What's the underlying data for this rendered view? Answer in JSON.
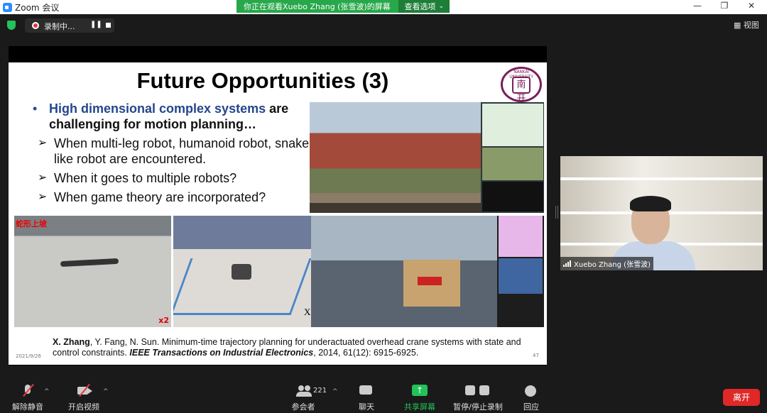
{
  "window": {
    "title": "Zoom 会议",
    "controls": [
      "minimize",
      "restore",
      "close"
    ]
  },
  "share_banner": {
    "message": "你正在观看Xuebo Zhang (张雪波)的屏幕",
    "options_label": "查看选项"
  },
  "topbar": {
    "recording_label": "录制中...",
    "view_label": "视图"
  },
  "slide": {
    "title": "Future Opportunities (3)",
    "logo_text": "NANKAI UNIVERSITY",
    "logo_glyph": "南开",
    "bullet_highlight": "High dimensional complex systems",
    "bullet_rest": " are challenging for motion planning…",
    "sub_bullets": [
      "When multi-leg robot, humanoid robot, snake-like robot are encountered.",
      "When it goes to multiple robots?",
      "When game theory are incorporated?"
    ],
    "photo_tag": "蛇形上坡",
    "speed_label": "x2",
    "x_label": "X",
    "citation_authors": "X. Zhang",
    "citation_mid": ", Y. Fang, N. Sun. Minimum-time trajectory planning for underactuated overhead crane systems with state and control constraints. ",
    "citation_journal": "IEEE Transactions on Industrial Electronics",
    "citation_end": ", 2014, 61(12): 6915-6925.",
    "date": "2021/9/26",
    "page_number": "47"
  },
  "video": {
    "participant_name": "Xuebo Zhang (张雪波)"
  },
  "toolbar": {
    "unmute_label": "解除静音",
    "start_video_label": "开启视频",
    "participants_label": "参会者",
    "participants_count": "221",
    "chat_label": "聊天",
    "share_label": "共享屏幕",
    "record_label": "暂停/停止录制",
    "react_label": "回应",
    "leave_label": "离开"
  },
  "colors": {
    "share_green": "#23c25a",
    "leave_red": "#e02828",
    "bullet_blue": "#24468c",
    "logo_purple": "#7a1f5a"
  }
}
